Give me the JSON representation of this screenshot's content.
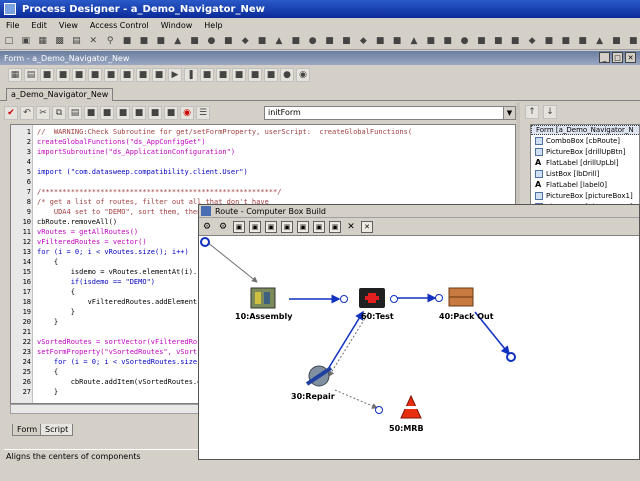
{
  "app": {
    "title": "Process Designer - a_Demo_Navigator_New",
    "menu": [
      "File",
      "Edit",
      "View",
      "Access Control",
      "Window",
      "Help"
    ]
  },
  "form_window": {
    "title": "Form - a_Demo_Navigator_New",
    "tab": "a_Demo_Navigator_New"
  },
  "editor": {
    "method": "initForm",
    "lines": [
      {
        "n": "1",
        "t": "//  WARNING:Check Subroutine for get/setFormProperty, userScript:  createGlobalFunctions(",
        "k": "cm"
      },
      {
        "n": "2",
        "t": "createGlobalFunctions(\"ds_AppConfigGet\")",
        "k": "fn"
      },
      {
        "n": "3",
        "t": "importSubroutine(\"ds_ApplicationConfiguration\")",
        "k": "fn"
      },
      {
        "n": "4",
        "t": "",
        "k": ""
      },
      {
        "n": "5",
        "t": "import (\"com.datasweep.compatibility.client.User\")",
        "k": "kw"
      },
      {
        "n": "6",
        "t": "",
        "k": ""
      },
      {
        "n": "7",
        "t": "/********************************************************/",
        "k": "cm"
      },
      {
        "n": "8",
        "t": "/* get a list of routes, filter out all that don't have",
        "k": "cm"
      },
      {
        "n": "9",
        "t": "    UDA4 set to \"DEMO\", sort them, then",
        "k": "cm"
      },
      {
        "n": "10",
        "t": "cbRoute.removeAll()",
        "k": ""
      },
      {
        "n": "11",
        "t": "vRoutes = getAllRoutes()",
        "k": "fn"
      },
      {
        "n": "12",
        "t": "vFilteredRoutes = vector()",
        "k": "fn"
      },
      {
        "n": "13",
        "t": "for (i = 0; i < vRoutes.size(); i++)",
        "k": "kw"
      },
      {
        "n": "14",
        "t": "    {",
        "k": ""
      },
      {
        "n": "15",
        "t": "        isdemo = vRoutes.elementAt(i).",
        "k": ""
      },
      {
        "n": "16",
        "t": "        if(isdemo == \"DEMO\")",
        "k": "kw"
      },
      {
        "n": "17",
        "t": "        {",
        "k": ""
      },
      {
        "n": "18",
        "t": "            vFilteredRoutes.addElement",
        "k": ""
      },
      {
        "n": "19",
        "t": "        }",
        "k": ""
      },
      {
        "n": "20",
        "t": "    }",
        "k": ""
      },
      {
        "n": "21",
        "t": "",
        "k": ""
      },
      {
        "n": "22",
        "t": "vSortedRoutes = sortVector(vFilteredRo",
        "k": "fn"
      },
      {
        "n": "23",
        "t": "setFormProperty(\"vSortedRoutes\", vSort",
        "k": "fn"
      },
      {
        "n": "24",
        "t": "    for (i = 0; i < vSortedRoutes.size",
        "k": "kw"
      },
      {
        "n": "25",
        "t": "    {",
        "k": ""
      },
      {
        "n": "26",
        "t": "        cbRoute.addItem(vSortedRoutes.e",
        "k": ""
      },
      {
        "n": "27",
        "t": "    }",
        "k": ""
      }
    ]
  },
  "bottom_tabs": [
    "Form",
    "Script"
  ],
  "status": "Aligns the centers of components",
  "properties_panel": {
    "selected": "Form [a_Demo_Navigator_N",
    "items": [
      {
        "icon": "box",
        "label": "ComboBox [cbRoute]"
      },
      {
        "icon": "box",
        "label": "PictureBox [drillUpBtn]"
      },
      {
        "icon": "A",
        "label": "FlatLabel [drillUpLbl]"
      },
      {
        "icon": "box",
        "label": "ListBox [lbDrill]"
      },
      {
        "icon": "A",
        "label": "FlatLabel [label0]"
      },
      {
        "icon": "box",
        "label": "PictureBox [pictureBox1]"
      },
      {
        "icon": "box",
        "label": "PictureBox [pictureBox2]"
      }
    ],
    "stubs": [
      "box2]",
      "box3]",
      "_AppC",
      "_Supe",
      "_Repo",
      "ton4]",
      "_Units",
      "ton3]",
      "_LineN",
      "_Supp",
      "ton1]",
      "_SPC]",
      "_OpCo",
      "_RMA",
      "_ECO",
      "ton2]",
      "ton7]"
    ]
  },
  "route_window": {
    "title": "Route - Computer Box Build",
    "nodes": [
      {
        "id": "assembly",
        "label": "10:Assembly"
      },
      {
        "id": "test",
        "label": "60:Test"
      },
      {
        "id": "packout",
        "label": "40:Pack Out"
      },
      {
        "id": "repair",
        "label": "30:Repair"
      },
      {
        "id": "mrb",
        "label": "50:MRB"
      }
    ]
  }
}
